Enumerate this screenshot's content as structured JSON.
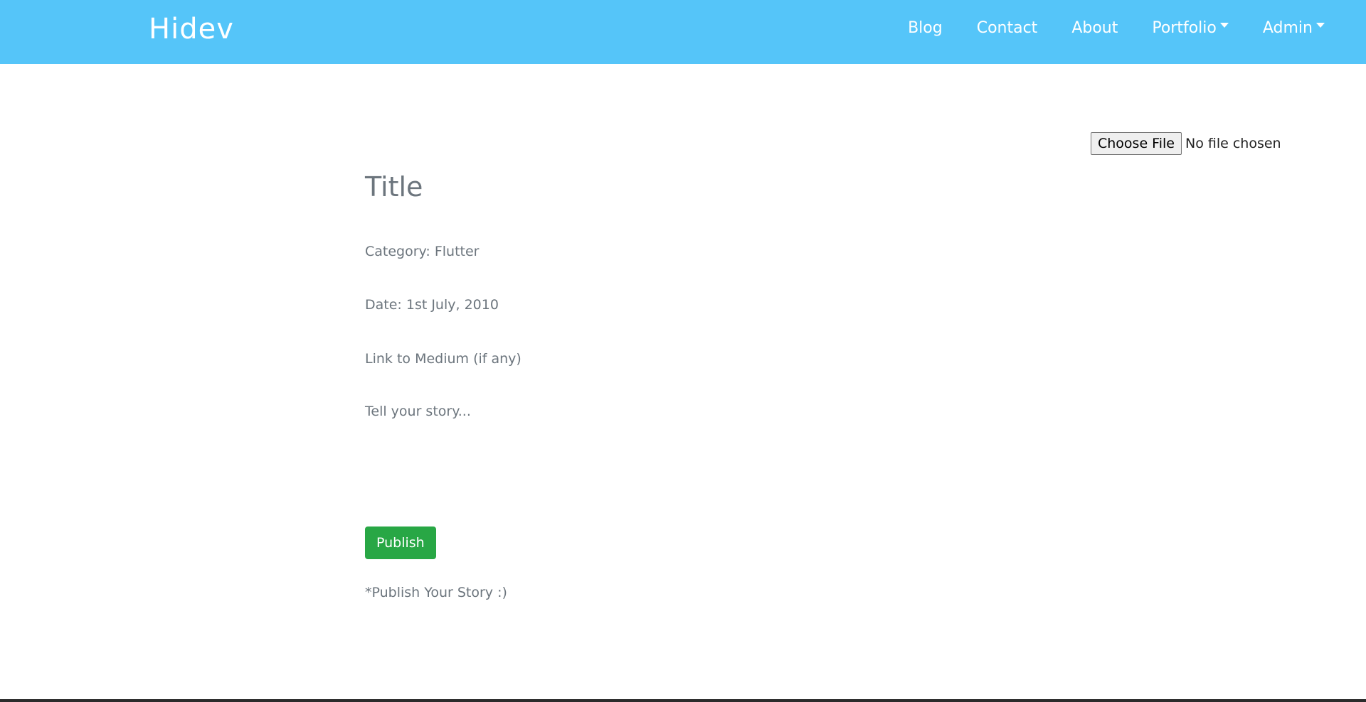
{
  "navbar": {
    "brand": "Hidev",
    "links": [
      {
        "label": "Blog"
      },
      {
        "label": "Contact"
      },
      {
        "label": "About"
      },
      {
        "label": "Portfolio"
      },
      {
        "label": "Admin"
      }
    ]
  },
  "file_upload": {
    "button_label": "Choose File",
    "status": "No file chosen"
  },
  "form": {
    "title_placeholder": "Title",
    "category": "Category: Flutter",
    "date": "Date: 1st July, 2010",
    "link_placeholder": "Link to Medium (if any)",
    "story_placeholder": "Tell your story...",
    "publish_label": "Publish",
    "note": "*Publish Your Story :)"
  },
  "colors": {
    "navbar_bg": "#55c5f9",
    "publish_bg": "#28a745",
    "placeholder_text": "#6c757d"
  }
}
